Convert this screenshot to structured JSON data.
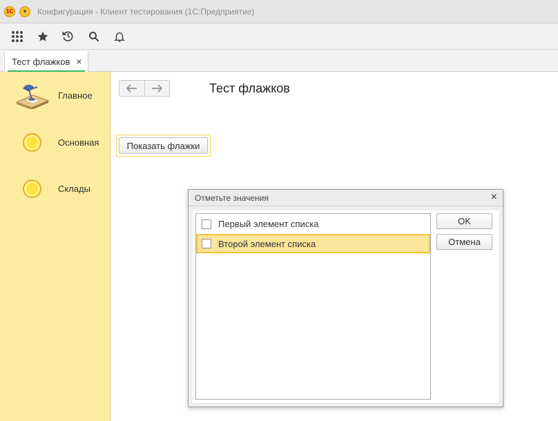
{
  "window": {
    "logo_text": "1С",
    "title": "Конфигурация  - Клиент тестирования (1С:Предприятие)"
  },
  "toolbar": {
    "icons": [
      "apps-grid-icon",
      "favorites-star-icon",
      "history-icon",
      "search-icon",
      "notifications-bell-icon"
    ]
  },
  "tabs": [
    {
      "label": "Тест флажков",
      "close": "×"
    }
  ],
  "sidebar": {
    "items": [
      {
        "label": "Главное",
        "icon": "desk-lamp-icon"
      },
      {
        "label": "Основная",
        "icon": "sun-icon"
      },
      {
        "label": "Склады",
        "icon": "sun-icon"
      }
    ]
  },
  "main": {
    "back_glyph": "🡐",
    "forward_glyph": "🡒",
    "title": "Тест флажков",
    "show_button": "Показать флажки"
  },
  "dialog": {
    "title": "Отметьте значения",
    "close": "×",
    "items": [
      {
        "label": "Первый элемент списка",
        "checked": false
      },
      {
        "label": "Второй элемент списка",
        "checked": false,
        "selected": true
      }
    ],
    "ok_label": "OK",
    "cancel_label": "Отмена"
  },
  "colors": {
    "sidebar_bg": "#fbeca0",
    "tab_accent": "#3cb66c",
    "selection_bg": "#fbe49b",
    "selection_border": "#f2c53a"
  }
}
